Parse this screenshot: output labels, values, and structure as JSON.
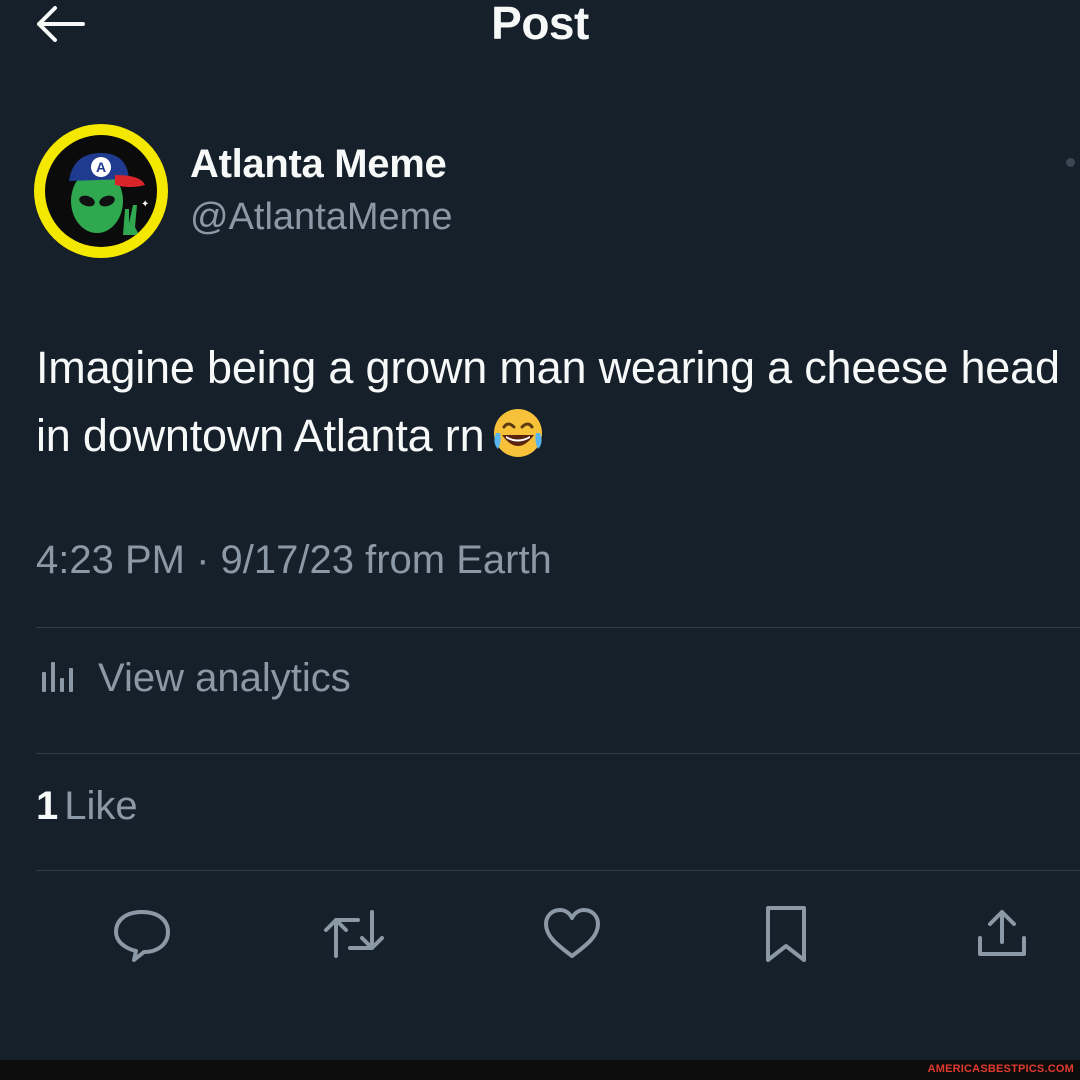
{
  "header": {
    "title": "Post",
    "back_icon": "arrow-left-icon"
  },
  "author": {
    "display_name": "Atlanta Meme",
    "handle": "@AtlantaMeme",
    "avatar_letter": "A"
  },
  "tweet": {
    "text": "Imagine being a grown man wearing a cheese head in downtown Atlanta rn",
    "emoji": "face-with-tears-of-joy",
    "meta": "4:23 PM · 9/17/23 from Earth"
  },
  "analytics": {
    "label": "View analytics",
    "icon": "analytics-bars-icon"
  },
  "engagement": {
    "likes_count": "1",
    "likes_label": "Like"
  },
  "actions": [
    {
      "name": "reply",
      "icon": "reply-icon"
    },
    {
      "name": "repost",
      "icon": "repost-icon"
    },
    {
      "name": "like",
      "icon": "heart-icon"
    },
    {
      "name": "bookmark",
      "icon": "bookmark-icon"
    },
    {
      "name": "share",
      "icon": "share-icon"
    }
  ],
  "watermark": "AMERICASBESTPICS.COM",
  "colors": {
    "background": "#15202b",
    "primary_text": "#f7f9f9",
    "secondary_text": "#8b98a5",
    "divider": "#2f3b47",
    "avatar_ring": "#f5e800",
    "watermark": "#e23b2e"
  }
}
